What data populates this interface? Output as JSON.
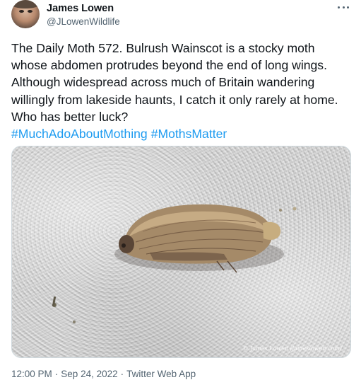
{
  "author": {
    "display_name": "James Lowen",
    "handle": "@JLowenWildlife"
  },
  "tweet": {
    "text": "The Daily Moth 572. Bulrush Wainscot is a stocky moth whose abdomen protrudes beyond the end of long wings. Although widespread across much of Britain wandering willingly from lakeside haunts, I catch it only rarely at home. Who has better luck?",
    "hashtags": [
      "#MuchAdoAboutMothing",
      "#MothsMatter"
    ]
  },
  "media": {
    "watermark": "© James Lowen (jameslowen.com)"
  },
  "meta": {
    "time": "12:00 PM",
    "date": "Sep 24, 2022",
    "separator": "·",
    "source": "Twitter Web App"
  },
  "icons": {
    "more": "more-horizontal-icon"
  },
  "colors": {
    "link": "#1d9bf0",
    "secondary_text": "#536471",
    "primary_text": "#0f1419"
  }
}
